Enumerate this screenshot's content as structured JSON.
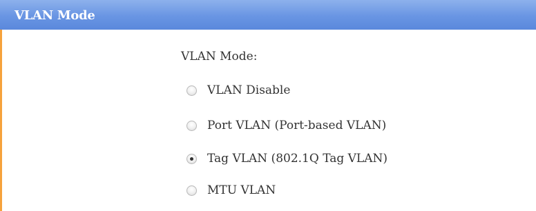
{
  "header": {
    "title": "VLAN Mode"
  },
  "form": {
    "label": "VLAN Mode:",
    "options": [
      {
        "label": "VLAN Disable",
        "checked": false
      },
      {
        "label": "Port VLAN (Port-based VLAN)",
        "checked": false
      },
      {
        "label": "Tag VLAN (802.1Q Tag VLAN)",
        "checked": true
      },
      {
        "label": "MTU VLAN",
        "checked": false
      }
    ]
  },
  "colors": {
    "header_bg": "#6995e3",
    "accent": "#f6a23c",
    "text": "#333333"
  }
}
